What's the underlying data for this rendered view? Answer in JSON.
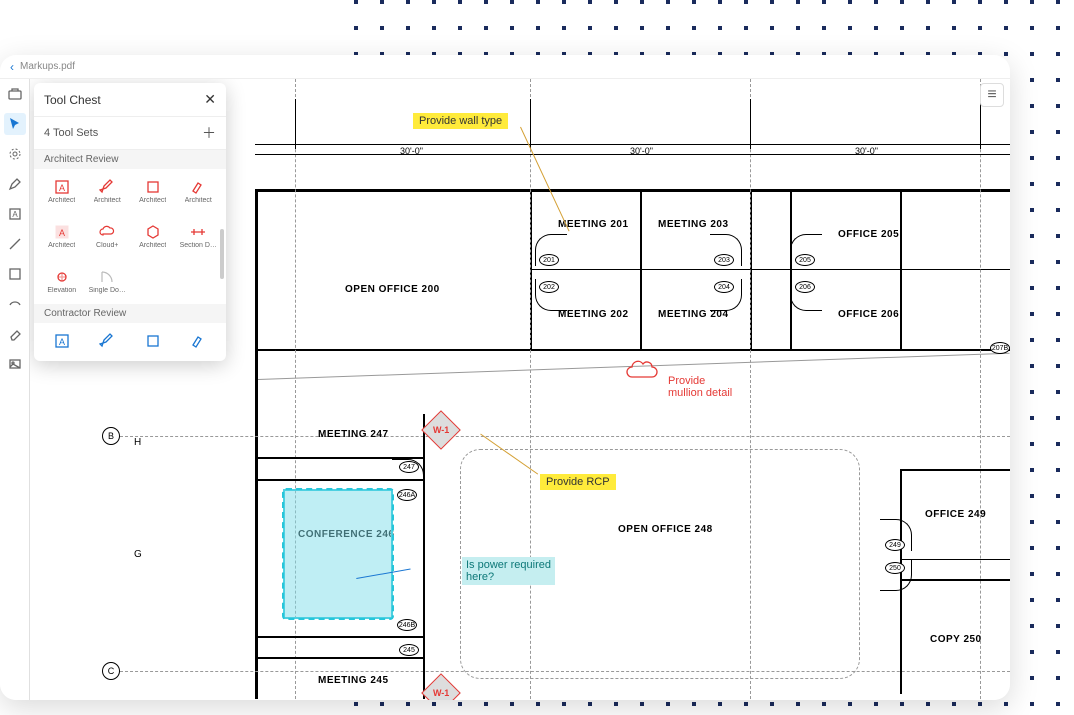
{
  "titlebar": {
    "filename": "Markups.pdf"
  },
  "panel": {
    "title": "Tool Chest",
    "subtitle": "4 Tool Sets",
    "section1": "Architect Review",
    "section2": "Contractor Review",
    "tools_row1": [
      {
        "label": "Architect",
        "icon": "A-box",
        "color": "red"
      },
      {
        "label": "Architect",
        "icon": "pen",
        "color": "red"
      },
      {
        "label": "Architect",
        "icon": "rect",
        "color": "red"
      },
      {
        "label": "Architect",
        "icon": "highlighter",
        "color": "red"
      }
    ],
    "tools_row2": [
      {
        "label": "Architect",
        "icon": "A-fill",
        "color": "red"
      },
      {
        "label": "Cloud+",
        "icon": "cloud",
        "color": "red"
      },
      {
        "label": "Architect",
        "icon": "hexagon",
        "color": "red"
      },
      {
        "label": "Section D…",
        "icon": "section",
        "color": "red"
      }
    ],
    "tools_row3": [
      {
        "label": "Elevation",
        "icon": "elevation",
        "color": "red"
      },
      {
        "label": "Single Do…",
        "icon": "door",
        "color": "grey"
      }
    ],
    "tools_row4": [
      {
        "label": "",
        "icon": "A-box",
        "color": "blue"
      },
      {
        "label": "",
        "icon": "pen",
        "color": "blue"
      },
      {
        "label": "",
        "icon": "rect",
        "color": "blue"
      },
      {
        "label": "",
        "icon": "highlighter",
        "color": "blue"
      }
    ]
  },
  "drawing": {
    "dims": [
      "30'-0\"",
      "30'-0\"",
      "30'-0\""
    ],
    "grid_labels": [
      "B",
      "C",
      "G",
      "H"
    ],
    "rooms": {
      "open200": "OPEN OFFICE  200",
      "m201": "MEETING  201",
      "m202": "MEETING  202",
      "m203": "MEETING  203",
      "m204": "MEETING  204",
      "o205": "OFFICE  205",
      "o206": "OFFICE  206",
      "m247": "MEETING  247",
      "conf246": "CONFERENCE  246",
      "open248": "OPEN OFFICE  248",
      "o249": "OFFICE  249",
      "copy250": "COPY  250",
      "m245": "MEETING  245"
    },
    "door_tags": {
      "t201": "201",
      "t202": "202",
      "t203": "203",
      "t204": "204",
      "t205": "205",
      "t206": "206",
      "t247": "247",
      "t246a": "246A",
      "t246b": "246B",
      "t245": "245",
      "t249": "249",
      "t250": "250",
      "t207b": "207B"
    },
    "markers": {
      "w1": "W-1"
    }
  },
  "annotations": {
    "wall_type": "Provide wall type",
    "mullion": "Provide\nmullion detail",
    "rcp": "Provide RCP",
    "power": "Is power required\nhere?"
  }
}
